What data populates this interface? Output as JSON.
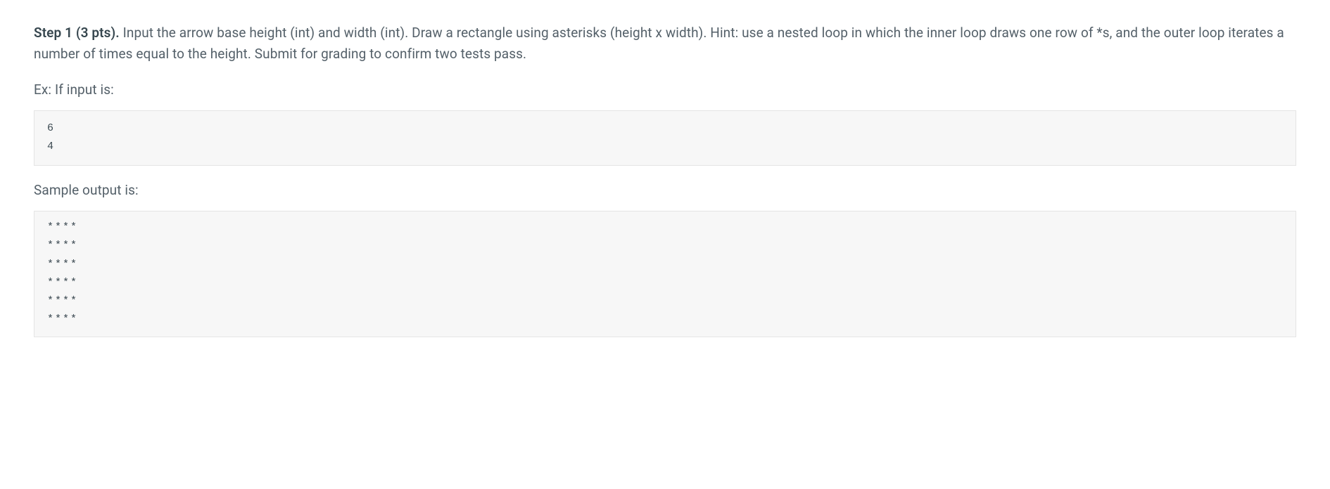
{
  "step": {
    "label": "Step 1 (3 pts).",
    "body": " Input the arrow base height (int) and width (int). Draw a rectangle using asterisks (height x width). Hint: use a nested loop in which the inner loop draws one row of *s, and the outer loop iterates a number of times equal to the height. Submit for grading to confirm two tests pass."
  },
  "example": {
    "label": "Ex: If input is:",
    "input": "6\n4",
    "output_label": "Sample output is:",
    "output": "****\n****\n****\n****\n****\n****"
  }
}
